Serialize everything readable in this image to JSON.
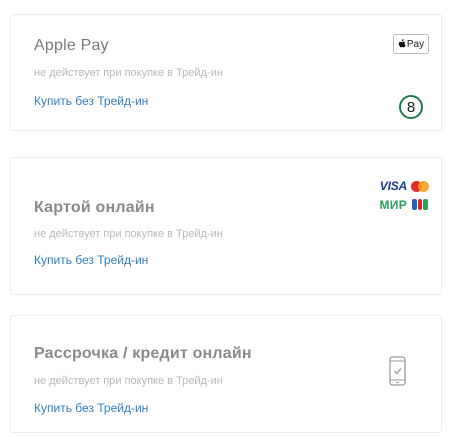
{
  "options": [
    {
      "title": "Apple Pay",
      "note": "не действует при покупке в Трейд-ин",
      "link": "Купить без Трейд-ин",
      "badge": "Pay",
      "step_number": "8",
      "icon": "apple-pay-logo"
    },
    {
      "title": "Картой онлайн",
      "note": "не действует при покупке в Трейд-ин",
      "link": "Купить без Трейд-ин",
      "logos": {
        "visa": "VISA",
        "mir": "МИР"
      },
      "icon": "card-brands-logos"
    },
    {
      "title": "Рассрочка / кредит онлайн",
      "note": "не действует при покупке в Трейд-ин",
      "link": "Купить без Трейд-ин",
      "icon": "phone-check-icon"
    }
  ],
  "colors": {
    "link": "#2f7ec0",
    "title": "#8a8a8a",
    "note": "#b8b8b8",
    "step_ring": "#1e7b4d",
    "visa": "#1a3a8a",
    "mir": "#2aa157",
    "mc_red": "#e52b2b",
    "mc_orange": "#f7a11a",
    "border": "#ececec"
  }
}
